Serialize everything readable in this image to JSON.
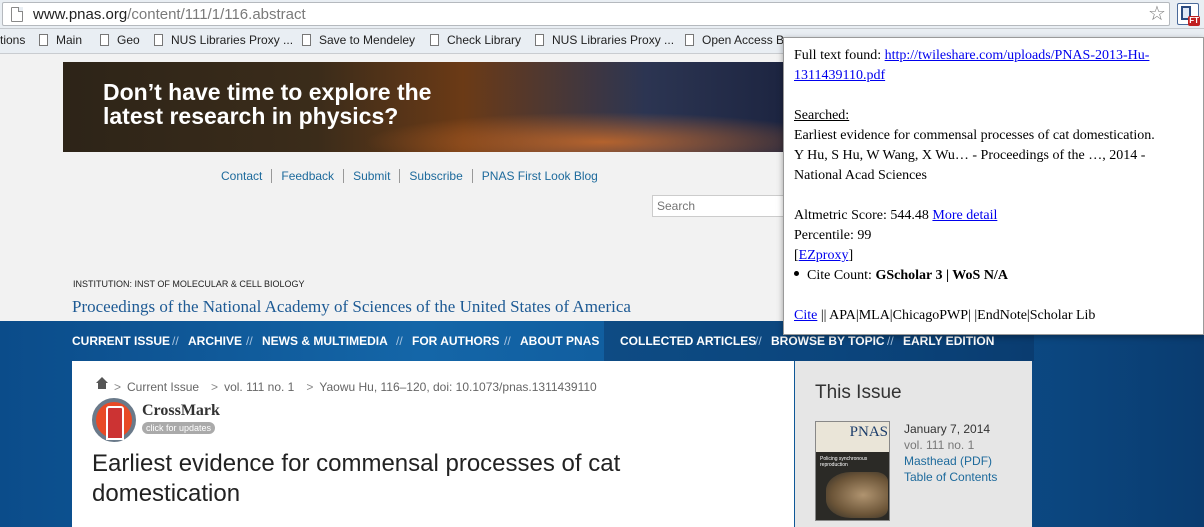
{
  "browser": {
    "url_host": "www.pnas.org",
    "url_path": "/content/111/1/116.abstract",
    "extension_badge": "FT",
    "bookmarks": [
      {
        "label": "tions"
      },
      {
        "label": "Main"
      },
      {
        "label": "Geo"
      },
      {
        "label": "NUS Libraries Proxy ..."
      },
      {
        "label": "Save to Mendeley"
      },
      {
        "label": "Check Library"
      },
      {
        "label": "NUS Libraries Proxy ..."
      },
      {
        "label": "Open Access Br"
      }
    ]
  },
  "banner": {
    "text": "Don’t have time to explore the\nlatest research in physics?"
  },
  "top_nav": [
    "Contact",
    "Feedback",
    "Submit",
    "Subscribe",
    "PNAS First Look Blog"
  ],
  "search": {
    "placeholder": "Search"
  },
  "institution": "Institution: INST OF MOLECULAR & CELL BIOLOGY",
  "journal_title": "Proceedings of the National Academy of Sciences of the United States of America",
  "main_nav": {
    "left": [
      "CURRENT ISSUE",
      "ARCHIVE",
      "NEWS & MULTIMEDIA",
      "FOR AUTHORS",
      "ABOUT PNAS"
    ],
    "right": [
      "COLLECTED ARTICLES",
      "BROWSE BY TOPIC",
      "EARLY EDITION"
    ],
    "separator": "//"
  },
  "breadcrumb": {
    "items": [
      "Current Issue",
      "vol. 111 no. 1",
      "Yaowu Hu,  116–120, doi: 10.1073/pnas.1311439110"
    ],
    "separator": ">"
  },
  "crossmark": {
    "title": "CrossMark",
    "subtitle": "click for updates"
  },
  "article_title": "Earliest evidence for commensal processes of cat domestication",
  "sidebar": {
    "title": "This Issue",
    "cover_word": "PNAS",
    "cover_tagline": "Policing synchronous reproduction",
    "date": "January 7, 2014",
    "volume": "vol. 111 no. 1",
    "links": [
      "Masthead (PDF)",
      "Table of Contents"
    ]
  },
  "popup": {
    "fulltext_label": "Full text found:",
    "fulltext_link_line1": "http://twileshare.com/uploads/PNAS-2013-Hu-",
    "fulltext_link_line2": "1311439110.pdf",
    "searched_label": "Searched:",
    "searched_line1": "Earliest evidence for commensal processes of cat domestication.",
    "searched_line2": "Y Hu, S Hu, W Wang, X Wu… - Proceedings of the …, 2014 -",
    "searched_line3": "National Acad Sciences",
    "altmetric_label": "Altmetric Score: 544.48",
    "altmetric_link": "More detail",
    "percentile": "Percentile: 99",
    "ezproxy": "EZproxy",
    "cite_count_label": "Cite Count:",
    "cite_count_value": "GScholar 3 | WoS N/A",
    "cite_link": "Cite",
    "cite_rest": " || APA|MLA|ChicagoPWP| |EndNote|Scholar Lib"
  }
}
